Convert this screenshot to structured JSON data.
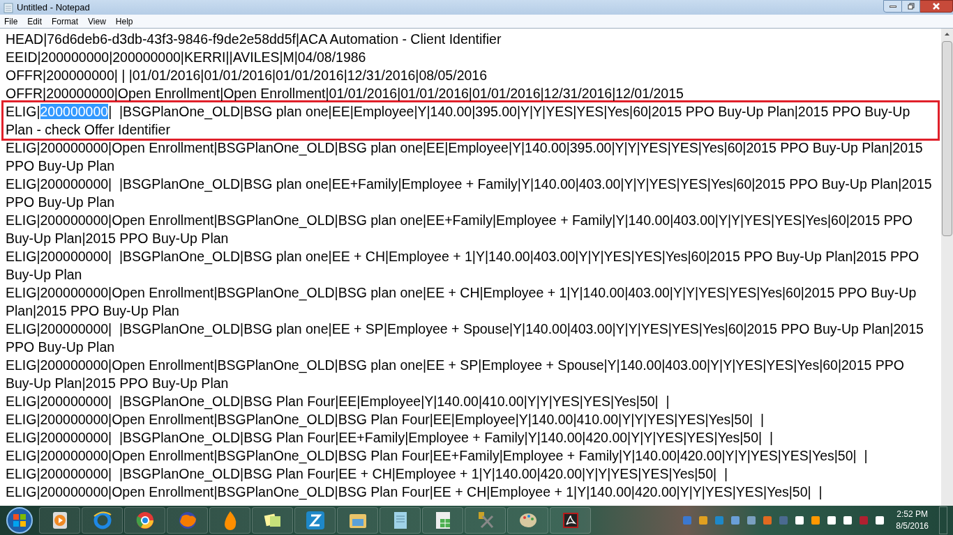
{
  "window": {
    "title": "Untitled - Notepad"
  },
  "menu": [
    {
      "label": "File"
    },
    {
      "label": "Edit"
    },
    {
      "label": "Format"
    },
    {
      "label": "View"
    },
    {
      "label": "Help"
    }
  ],
  "lines": [
    {
      "kind": "plain",
      "text": "HEAD|76d6deb6-d3db-43f3-9846-f9de2e58dd5f|ACA Automation - Client Identifier"
    },
    {
      "kind": "plain",
      "text": "EEID|200000000|200000000|KERRI||AVILES|M|04/08/1986"
    },
    {
      "kind": "plain",
      "text": "OFFR|200000000| | |01/01/2016|01/01/2016|01/01/2016|12/31/2016|08/05/2016"
    },
    {
      "kind": "plain",
      "text": "OFFR|200000000|Open Enrollment|Open Enrollment|01/01/2016|01/01/2016|01/01/2016|12/31/2016|12/01/2015"
    },
    {
      "kind": "outlined",
      "before": "ELIG|",
      "selected_text": "200000000",
      "after": "|  |BSGPlanOne_OLD|BSG plan one|EE|Employee|Y|140.00|395.00|Y|Y|YES|YES|Yes|60|2015 PPO Buy-Up Plan|2015 PPO Buy-Up Plan - check Offer Identifier"
    },
    {
      "kind": "plain",
      "text": "ELIG|200000000|Open Enrollment|BSGPlanOne_OLD|BSG plan one|EE|Employee|Y|140.00|395.00|Y|Y|YES|YES|Yes|60|2015 PPO Buy-Up Plan|2015 PPO Buy-Up Plan"
    },
    {
      "kind": "plain",
      "text": "ELIG|200000000|  |BSGPlanOne_OLD|BSG plan one|EE+Family|Employee + Family|Y|140.00|403.00|Y|Y|YES|YES|Yes|60|2015 PPO Buy-Up Plan|2015 PPO Buy-Up Plan"
    },
    {
      "kind": "plain",
      "text": "ELIG|200000000|Open Enrollment|BSGPlanOne_OLD|BSG plan one|EE+Family|Employee + Family|Y|140.00|403.00|Y|Y|YES|YES|Yes|60|2015 PPO Buy-Up Plan|2015 PPO Buy-Up Plan"
    },
    {
      "kind": "plain",
      "text": "ELIG|200000000|  |BSGPlanOne_OLD|BSG plan one|EE + CH|Employee + 1|Y|140.00|403.00|Y|Y|YES|YES|Yes|60|2015 PPO Buy-Up Plan|2015 PPO Buy-Up Plan"
    },
    {
      "kind": "plain",
      "text": "ELIG|200000000|Open Enrollment|BSGPlanOne_OLD|BSG plan one|EE + CH|Employee + 1|Y|140.00|403.00|Y|Y|YES|YES|Yes|60|2015 PPO Buy-Up Plan|2015 PPO Buy-Up Plan"
    },
    {
      "kind": "plain",
      "text": "ELIG|200000000|  |BSGPlanOne_OLD|BSG plan one|EE + SP|Employee + Spouse|Y|140.00|403.00|Y|Y|YES|YES|Yes|60|2015 PPO Buy-Up Plan|2015 PPO Buy-Up Plan"
    },
    {
      "kind": "plain",
      "text": "ELIG|200000000|Open Enrollment|BSGPlanOne_OLD|BSG plan one|EE + SP|Employee + Spouse|Y|140.00|403.00|Y|Y|YES|YES|Yes|60|2015 PPO Buy-Up Plan|2015 PPO Buy-Up Plan"
    },
    {
      "kind": "plain",
      "text": "ELIG|200000000|  |BSGPlanOne_OLD|BSG Plan Four|EE|Employee|Y|140.00|410.00|Y|Y|YES|YES|Yes|50|  |"
    },
    {
      "kind": "plain",
      "text": "ELIG|200000000|Open Enrollment|BSGPlanOne_OLD|BSG Plan Four|EE|Employee|Y|140.00|410.00|Y|Y|YES|YES|Yes|50|  |"
    },
    {
      "kind": "plain",
      "text": "ELIG|200000000|  |BSGPlanOne_OLD|BSG Plan Four|EE+Family|Employee + Family|Y|140.00|420.00|Y|Y|YES|YES|Yes|50|  |"
    },
    {
      "kind": "plain",
      "text": "ELIG|200000000|Open Enrollment|BSGPlanOne_OLD|BSG Plan Four|EE+Family|Employee + Family|Y|140.00|420.00|Y|Y|YES|YES|Yes|50|  |"
    },
    {
      "kind": "plain",
      "text": "ELIG|200000000|  |BSGPlanOne_OLD|BSG Plan Four|EE + CH|Employee + 1|Y|140.00|420.00|Y|Y|YES|YES|Yes|50|  |"
    },
    {
      "kind": "plain",
      "text": "ELIG|200000000|Open Enrollment|BSGPlanOne_OLD|BSG Plan Four|EE + CH|Employee + 1|Y|140.00|420.00|Y|Y|YES|YES|Yes|50|  |"
    }
  ],
  "clock": {
    "time": "2:52 PM",
    "date": "8/5/2016"
  }
}
